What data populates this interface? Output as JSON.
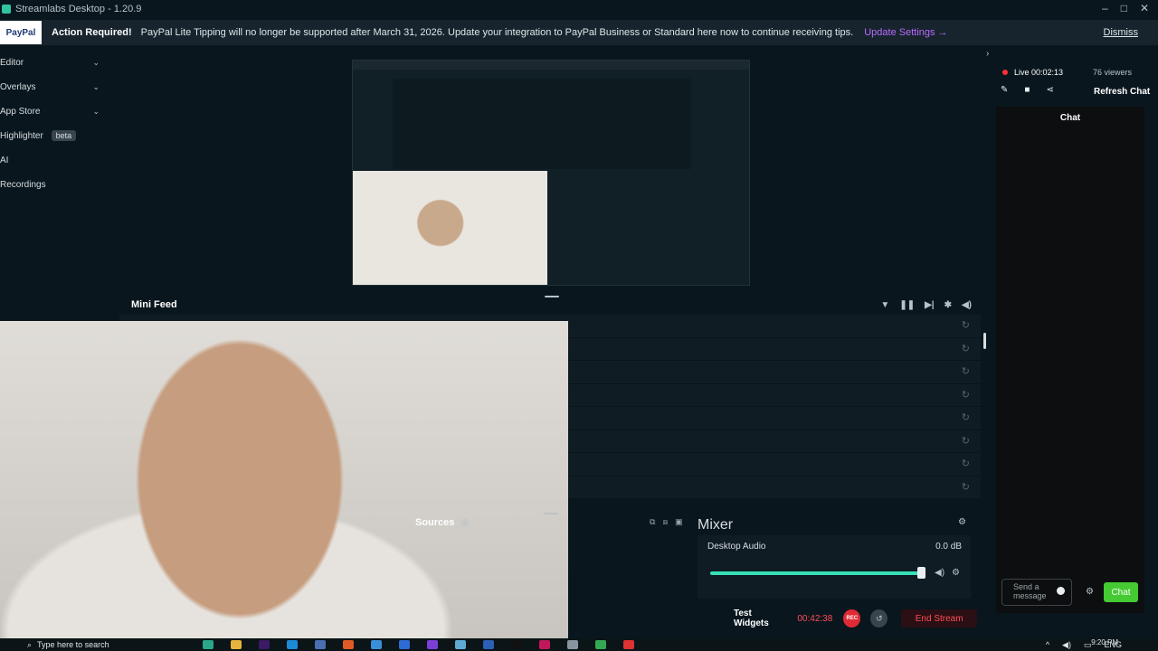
{
  "titlebar": {
    "title": "Streamlabs Desktop - 1.20.9"
  },
  "banner": {
    "logo": "PayPal",
    "required_label": "Action Required!",
    "message": "PayPal Lite Tipping will no longer be supported after March 31, 2026. Update your integration to PayPal Business or Standard here now to continue receiving tips.",
    "update_link": "Update Settings →",
    "dismiss_label": "Dismiss"
  },
  "sidebar": {
    "items": [
      {
        "label": "Editor",
        "chevron": "chevron-down-icon"
      },
      {
        "label": "Overlays",
        "chevron": "chevron-down-icon"
      },
      {
        "label": "App Store",
        "chevron": "chevron-down-icon"
      },
      {
        "label": "Highlighter",
        "badge": "beta"
      },
      {
        "label": "AI"
      },
      {
        "label": "Recordings"
      }
    ]
  },
  "minifeed": {
    "title": "Mini Feed",
    "row_count": 8
  },
  "sources": {
    "title": "Sources"
  },
  "mixer": {
    "title": "Mixer",
    "channel": {
      "name": "Desktop Audio",
      "level": "0.0 dB",
      "volume_fraction": 0.97
    }
  },
  "footer": {
    "test_widgets": "Test Widgets",
    "timer": "00:42:38",
    "rec_label": "REC",
    "end_stream": "End Stream"
  },
  "right_panel": {
    "live_label": "Live 00:02:13",
    "viewers": "76 viewers",
    "refresh_chat": "Refresh Chat",
    "chat_title": "Chat",
    "chat_placeholder": "Send a message",
    "chat_button": "Chat"
  },
  "taskbar": {
    "search_placeholder": "Type here to search",
    "lang": "ENG",
    "time": "9:20 PM"
  },
  "colors": {
    "bg": "#09161d",
    "accent_teal": "#39e0b7",
    "live_red": "#ff2f3c",
    "chat_green": "#45ca33",
    "link_purple": "#b86bff"
  }
}
